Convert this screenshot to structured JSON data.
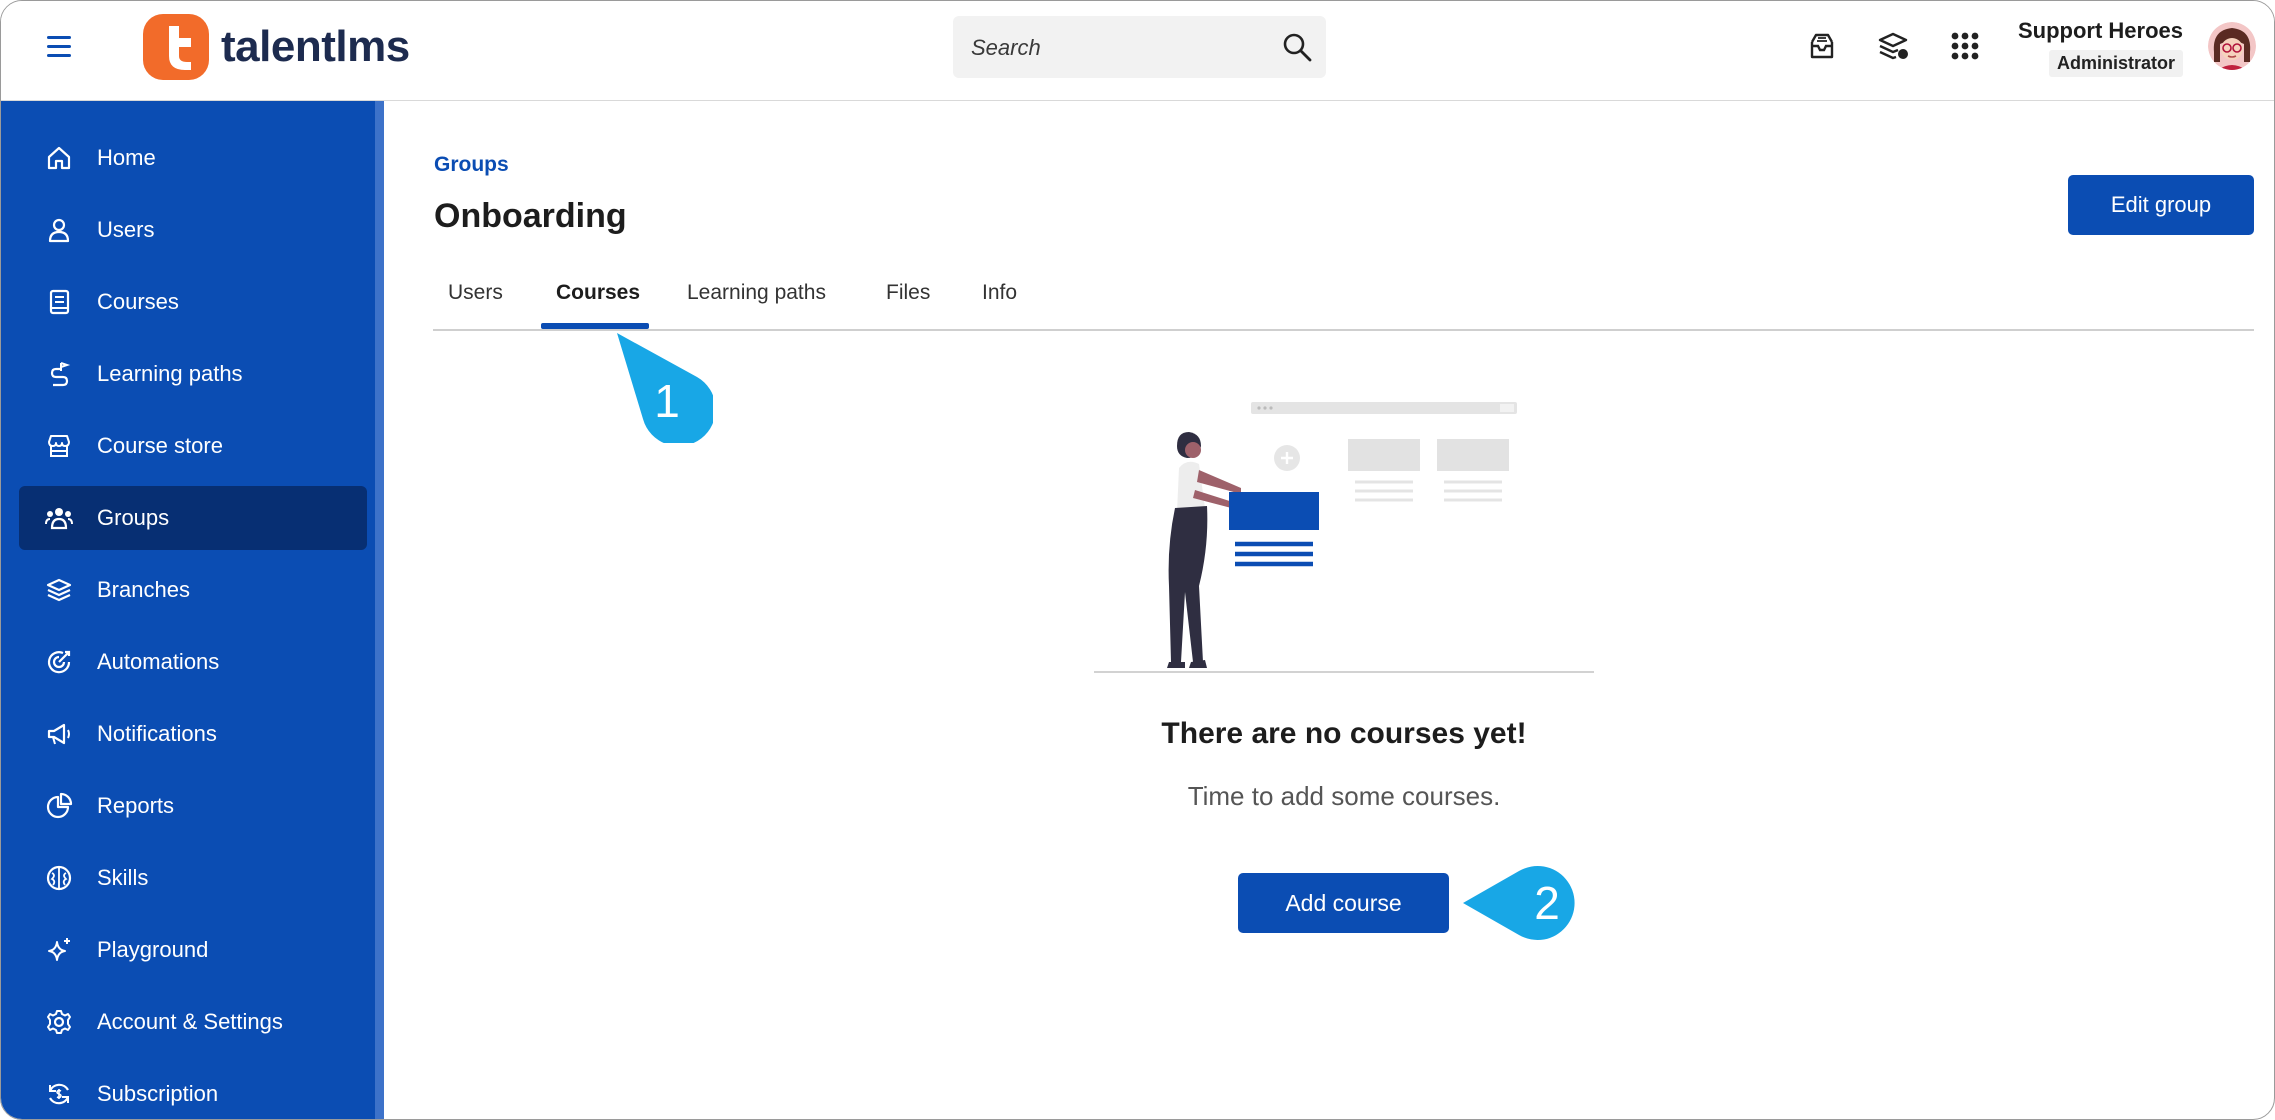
{
  "header": {
    "brand": "talentlms",
    "search": {
      "placeholder": "Search",
      "value": ""
    },
    "user": {
      "name": "Support Heroes",
      "role": "Administrator"
    },
    "icons": [
      "menu-icon",
      "inbox-icon",
      "courses-stack-icon",
      "apps-grid-icon",
      "avatar"
    ]
  },
  "sidebar": {
    "items": [
      {
        "label": "Home",
        "icon": "home-icon"
      },
      {
        "label": "Users",
        "icon": "user-icon"
      },
      {
        "label": "Courses",
        "icon": "book-icon"
      },
      {
        "label": "Learning paths",
        "icon": "path-icon"
      },
      {
        "label": "Course store",
        "icon": "store-icon"
      },
      {
        "label": "Groups",
        "icon": "groups-icon",
        "active": true
      },
      {
        "label": "Branches",
        "icon": "layers-icon"
      },
      {
        "label": "Automations",
        "icon": "automations-icon"
      },
      {
        "label": "Notifications",
        "icon": "megaphone-icon"
      },
      {
        "label": "Reports",
        "icon": "pie-chart-icon"
      },
      {
        "label": "Skills",
        "icon": "brain-icon"
      },
      {
        "label": "Playground",
        "icon": "sparkle-icon"
      },
      {
        "label": "Account & Settings",
        "icon": "gear-icon"
      },
      {
        "label": "Subscription",
        "icon": "subscription-icon"
      }
    ]
  },
  "main": {
    "breadcrumb": "Groups",
    "title": "Onboarding",
    "edit_button": "Edit group",
    "tabs": [
      {
        "label": "Users"
      },
      {
        "label": "Courses",
        "active": true
      },
      {
        "label": "Learning paths"
      },
      {
        "label": "Files"
      },
      {
        "label": "Info"
      }
    ],
    "empty_state": {
      "title": "There are no courses yet!",
      "subtitle": "Time to add some courses.",
      "button": "Add course"
    }
  },
  "callouts": [
    {
      "number": "1"
    },
    {
      "number": "2"
    }
  ],
  "colors": {
    "primary": "#0b4db3",
    "sidebar_active": "#072f73",
    "callout": "#18a7e6",
    "logo": "#f26b2a"
  }
}
